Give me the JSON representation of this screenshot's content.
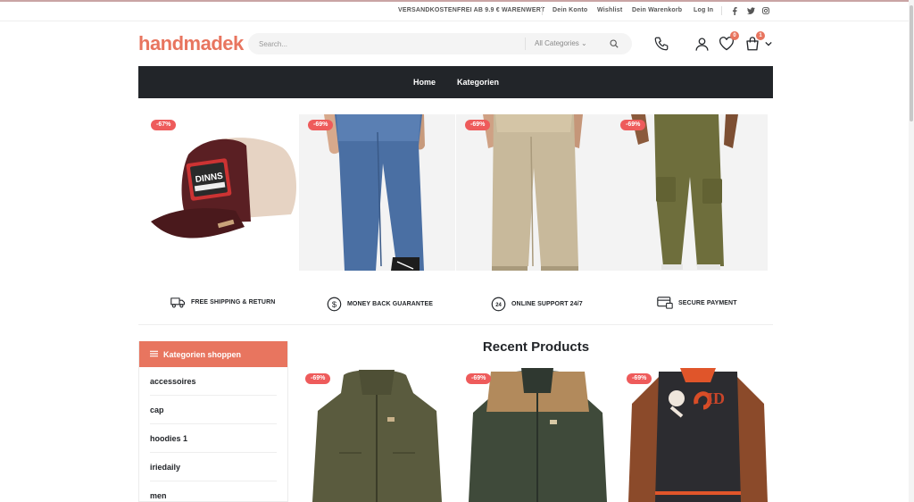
{
  "topbar": {
    "shipping_notice": "VERSANDKOSTENFREI AB 9.9 € WARENWERT",
    "links": [
      "Dein Konto",
      "Wishlist",
      "Dein Warenkorb",
      "Log In"
    ],
    "social_icons": [
      "facebook-icon",
      "twitter-icon",
      "instagram-icon"
    ]
  },
  "header": {
    "logo": "handmadek",
    "search_placeholder": "Search...",
    "category_select": "All Categories",
    "wishlist_count": "0",
    "cart_count": "1"
  },
  "nav": {
    "items": [
      "Home",
      "Kategorien"
    ]
  },
  "products_top": [
    {
      "discount": "-67%"
    },
    {
      "discount": "-69%"
    },
    {
      "discount": "-69%"
    },
    {
      "discount": "-69%"
    }
  ],
  "features": [
    {
      "label": "FREE SHIPPING & RETURN",
      "icon": "truck-icon"
    },
    {
      "label": "MONEY BACK GUARANTEE",
      "icon": "dollar-circle-icon"
    },
    {
      "label": "ONLINE SUPPORT 24/7",
      "icon": "support-24-icon"
    },
    {
      "label": "SECURE PAYMENT",
      "icon": "secure-card-icon"
    }
  ],
  "sidebar": {
    "title": "Kategorien shoppen",
    "items": [
      "accessoires",
      "cap",
      "hoodies 1",
      "iriedaily",
      "men"
    ]
  },
  "recent": {
    "title": "Recent Products",
    "items": [
      {
        "discount": "-69%"
      },
      {
        "discount": "-69%"
      },
      {
        "discount": "-69%"
      }
    ]
  },
  "colors": {
    "accent": "#e8755f",
    "dark": "#222529",
    "sale": "#ee5b5b"
  }
}
